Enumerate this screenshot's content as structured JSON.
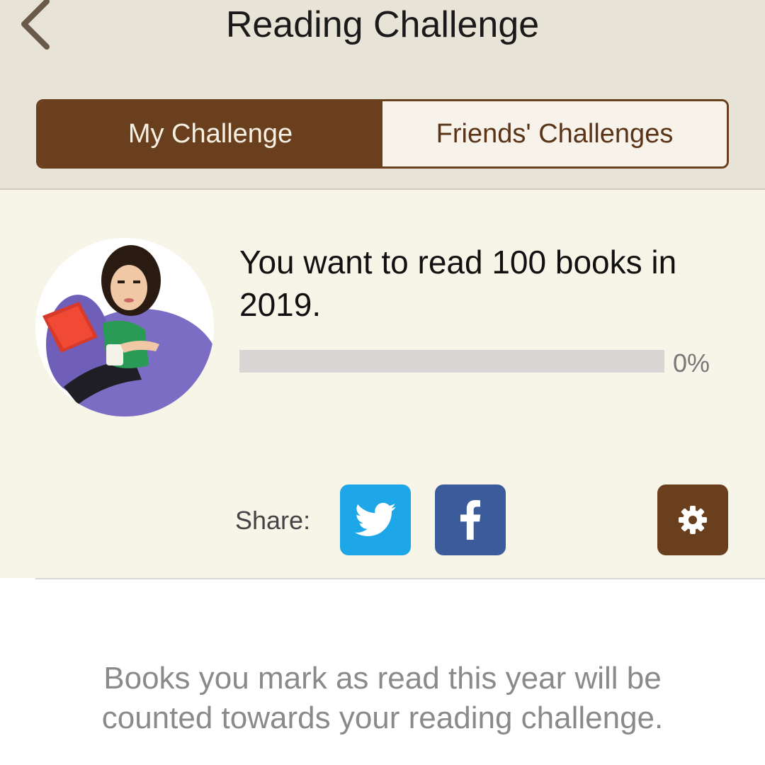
{
  "header": {
    "title": "Reading Challenge",
    "back_icon": "chevron-left-icon"
  },
  "tabs": [
    {
      "label": "My Challenge",
      "active": true
    },
    {
      "label": "Friends' Challenges",
      "active": false
    }
  ],
  "challenge": {
    "goal_text": "You want to read 100 books in 2019.",
    "progress_fraction": 0.0,
    "progress_label": "0%"
  },
  "share": {
    "label": "Share:",
    "twitter_icon": "twitter-icon",
    "facebook_icon": "facebook-icon",
    "settings_icon": "gear-icon"
  },
  "info_text": "Books you mark as read this year will be counted towards your reading challenge.",
  "colors": {
    "brand_brown": "#6a3f1d",
    "header_bg": "#e8e3d7",
    "panel_bg": "#f7f4e8",
    "twitter_blue": "#1da6e8",
    "facebook_blue": "#3b5b9a",
    "track_gray": "#d7d6d5"
  }
}
